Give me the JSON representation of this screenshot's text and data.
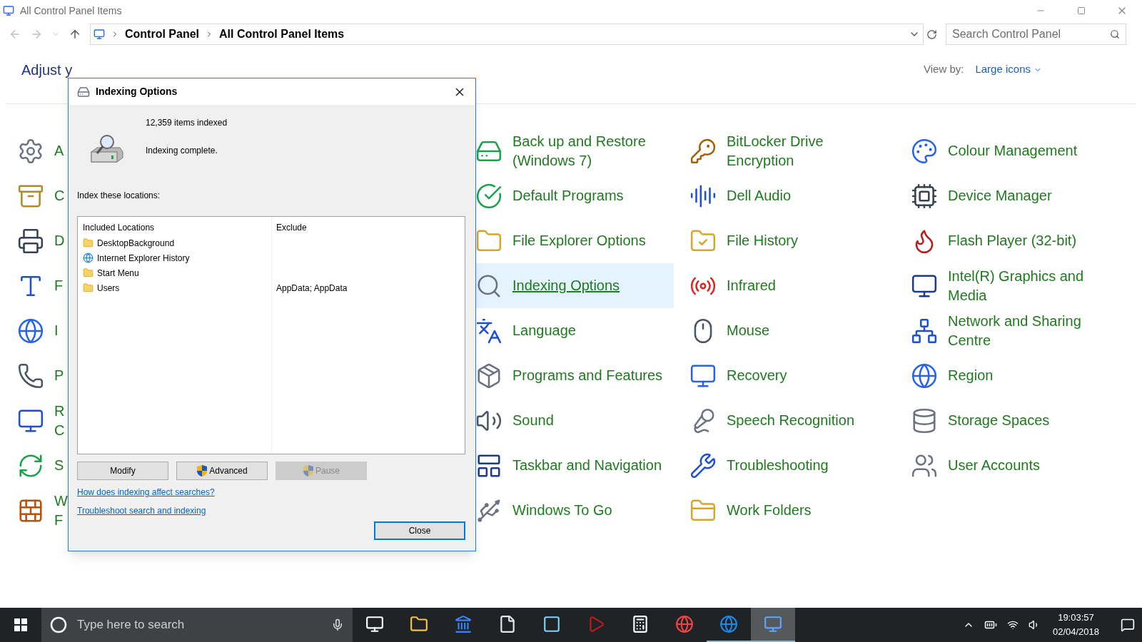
{
  "window": {
    "title": "All Control Panel Items"
  },
  "address": {
    "crumbs": [
      "Control Panel",
      "All Control Panel Items"
    ]
  },
  "search": {
    "placeholder": "Search Control Panel"
  },
  "header": {
    "heading": "Adjust y",
    "view_by_label": "View by:",
    "view_by_value": "Large icons"
  },
  "columns": [
    [
      {
        "label": "A",
        "selected": false
      },
      {
        "label": "C",
        "selected": false
      },
      {
        "label": "D",
        "selected": false
      },
      {
        "label": "F",
        "selected": false
      },
      {
        "label": "I",
        "selected": false
      },
      {
        "label": "P",
        "selected": false
      },
      {
        "label": "R C",
        "selected": false
      },
      {
        "label": "S",
        "selected": false
      },
      {
        "label": "W F",
        "selected": false
      }
    ],
    [
      {
        "label": "Back up and Restore (Windows 7)",
        "selected": false
      },
      {
        "label": "Default Programs",
        "selected": false
      },
      {
        "label": "File Explorer Options",
        "selected": false
      },
      {
        "label": "Indexing Options",
        "selected": true
      },
      {
        "label": "Language",
        "selected": false
      },
      {
        "label": "Programs and Features",
        "selected": false
      },
      {
        "label": "Sound",
        "selected": false
      },
      {
        "label": "Taskbar and Navigation",
        "selected": false
      },
      {
        "label": "Windows To Go",
        "selected": false
      }
    ],
    [
      {
        "label": "BitLocker Drive Encryption",
        "selected": false
      },
      {
        "label": "Dell Audio",
        "selected": false
      },
      {
        "label": "File History",
        "selected": false
      },
      {
        "label": "Infrared",
        "selected": false
      },
      {
        "label": "Mouse",
        "selected": false
      },
      {
        "label": "Recovery",
        "selected": false
      },
      {
        "label": "Speech Recognition",
        "selected": false
      },
      {
        "label": "Troubleshooting",
        "selected": false
      },
      {
        "label": "Work Folders",
        "selected": false
      }
    ],
    [
      {
        "label": "Colour Management",
        "selected": false
      },
      {
        "label": "Device Manager",
        "selected": false
      },
      {
        "label": "Flash Player (32-bit)",
        "selected": false
      },
      {
        "label": "Intel(R) Graphics and Media",
        "selected": false
      },
      {
        "label": "Network and Sharing Centre",
        "selected": false
      },
      {
        "label": "Region",
        "selected": false
      },
      {
        "label": "Storage Spaces",
        "selected": false
      },
      {
        "label": "User Accounts",
        "selected": false
      }
    ]
  ],
  "dialog": {
    "title": "Indexing Options",
    "count": "12,359 items indexed",
    "status": "Indexing complete.",
    "list_label": "Index these locations:",
    "table": {
      "columns": [
        "Included Locations",
        "Exclude"
      ],
      "rows": [
        {
          "kind": "folder",
          "location": "DesktopBackground"
        },
        {
          "kind": "browser",
          "location": "Internet Explorer History"
        },
        {
          "kind": "folder",
          "location": "Start Menu"
        },
        {
          "kind": "folder",
          "location": "Users",
          "exclude": "AppData; AppData"
        }
      ]
    },
    "buttons": [
      {
        "label": "Modify",
        "shield": false,
        "disabled": false
      },
      {
        "label": "Advanced",
        "shield": true,
        "disabled": false
      },
      {
        "label": "Pause",
        "shield": true,
        "disabled": true
      }
    ],
    "links": [
      "How does indexing affect searches?",
      "Troubleshoot search and indexing"
    ],
    "close_button": "Close"
  },
  "taskbar": {
    "search_placeholder": "Type here to search",
    "apps": [
      {
        "running": false,
        "selected": false
      },
      {
        "running": false,
        "selected": false
      },
      {
        "running": false,
        "selected": false
      },
      {
        "running": false,
        "selected": false
      },
      {
        "running": false,
        "selected": false
      },
      {
        "running": false,
        "selected": false
      },
      {
        "running": false,
        "selected": false
      },
      {
        "running": false,
        "selected": false
      },
      {
        "running": true,
        "selected": false
      },
      {
        "running": true,
        "selected": true
      }
    ],
    "time": "19:03:57",
    "date": "02/04/2018"
  }
}
